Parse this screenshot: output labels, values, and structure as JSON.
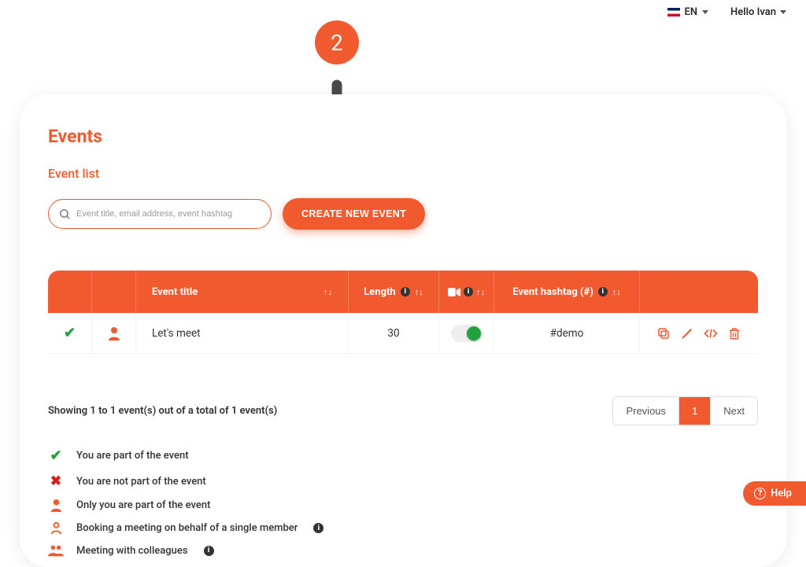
{
  "topbar": {
    "lang_code": "EN",
    "greeting": "Hello Ivan"
  },
  "page": {
    "title": "Events",
    "subtitle": "Event list"
  },
  "search": {
    "placeholder": "Event title, email address, event hashtag"
  },
  "buttons": {
    "create": "CREATE NEW EVENT"
  },
  "table": {
    "headers": {
      "title": "Event title",
      "length": "Length",
      "hashtag": "Event hashtag (#)"
    },
    "rows": [
      {
        "is_member": true,
        "person_kind": "single",
        "title": "Let's meet",
        "length": "30",
        "video_on": true,
        "hashtag": "#demo"
      }
    ]
  },
  "pagination": {
    "summary": "Showing 1 to 1 event(s) out of a total of 1 event(s)",
    "prev": "Previous",
    "next": "Next",
    "current": "1"
  },
  "legend": {
    "member": "You are part of the event",
    "not_member": "You are not part of the event",
    "only_you": "Only you are part of the event",
    "behalf_single": "Booking a meeting on behalf of a single member",
    "colleagues": "Meeting with colleagues"
  },
  "callouts": {
    "a": "2",
    "b": "2"
  },
  "help": {
    "label": "Help"
  },
  "colors": {
    "accent": "#f15a2e",
    "success": "#1fa33a",
    "danger": "#d41e1e"
  }
}
